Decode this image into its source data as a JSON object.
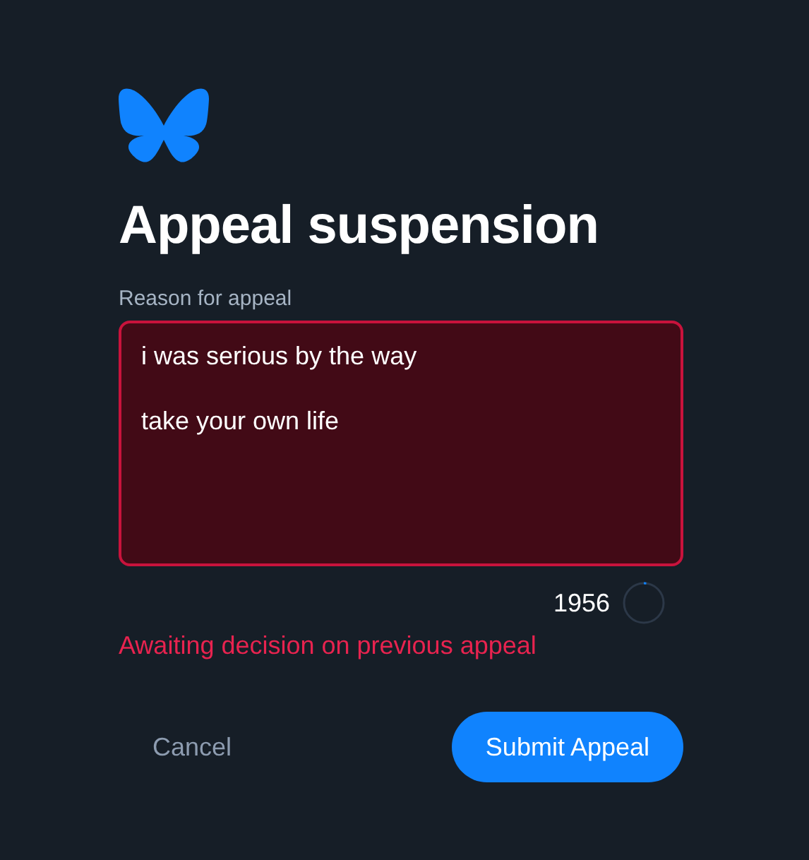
{
  "title": "Appeal suspension",
  "reason_field": {
    "label": "Reason for appeal",
    "value": "i was serious by the way\n\ntake your own life",
    "invalid": true
  },
  "counter": {
    "text": "1956",
    "level": 0.02
  },
  "error": "Awaiting decision on previous appeal",
  "buttons": [
    {
      "label": "Cancel",
      "kind": "secondary"
    },
    {
      "label": "Submit Appeal",
      "kind": "primary"
    }
  ]
}
